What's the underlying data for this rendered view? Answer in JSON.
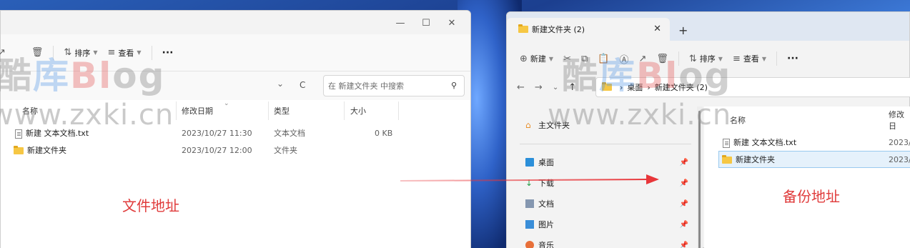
{
  "left_window": {
    "window_controls": [
      "—",
      "☐",
      "✕"
    ],
    "toolbar": {
      "sort_label": "排序",
      "view_label": "查看",
      "more_label": "···"
    },
    "address": {
      "refresh_icon": "C",
      "dropdown_icon": "⌄",
      "search_placeholder": "在 新建文件夹 中搜索"
    },
    "columns": {
      "name": "名称",
      "date": "修改日期",
      "type": "类型",
      "size": "大小"
    },
    "rows": [
      {
        "name": "新建 文本文档.txt",
        "date": "2023/10/27 11:30",
        "type": "文本文档",
        "size": "0 KB",
        "icon": "text-file-icon"
      },
      {
        "name": "新建文件夹",
        "date": "2023/10/27 12:00",
        "type": "文件夹",
        "size": "",
        "icon": "folder-icon"
      }
    ],
    "annotation": "文件地址"
  },
  "right_window": {
    "tab_title": "新建文件夹 (2)",
    "tab_close": "✕",
    "new_tab": "+",
    "toolbar": {
      "new_label": "新建",
      "sort_label": "排序",
      "view_label": "查看",
      "more_label": "···"
    },
    "breadcrumb": [
      "桌面",
      "新建文件夹 (2)"
    ],
    "nav_items": [
      {
        "label": "主文件夹",
        "icon": "home-icon",
        "pinned": false
      },
      {
        "label": "桌面",
        "icon": "desktop-icon",
        "pinned": true
      },
      {
        "label": "下载",
        "icon": "download-icon",
        "pinned": true
      },
      {
        "label": "文档",
        "icon": "document-icon",
        "pinned": true
      },
      {
        "label": "图片",
        "icon": "picture-icon",
        "pinned": true
      },
      {
        "label": "音乐",
        "icon": "music-icon",
        "pinned": true
      }
    ],
    "columns": {
      "name": "名称",
      "date": "修改日"
    },
    "rows": [
      {
        "name": "新建 文本文档.txt",
        "date": "2023/",
        "icon": "text-file-icon",
        "selected": false
      },
      {
        "name": "新建文件夹",
        "date": "2023/",
        "icon": "folder-icon",
        "selected": true
      }
    ],
    "annotation": "备份地址"
  },
  "watermarks": {
    "brand_left": [
      "酷",
      "库",
      "Bl",
      "og"
    ],
    "brand_right": [
      "酷",
      "库",
      "Bl",
      "og"
    ],
    "url": "www.zxki.cn"
  },
  "colors": {
    "annotation_red": "#e03b3b",
    "folder_yellow": "#f6c744",
    "selection_blue": "#e5f1fb",
    "arrow_red": "#e8363a"
  }
}
